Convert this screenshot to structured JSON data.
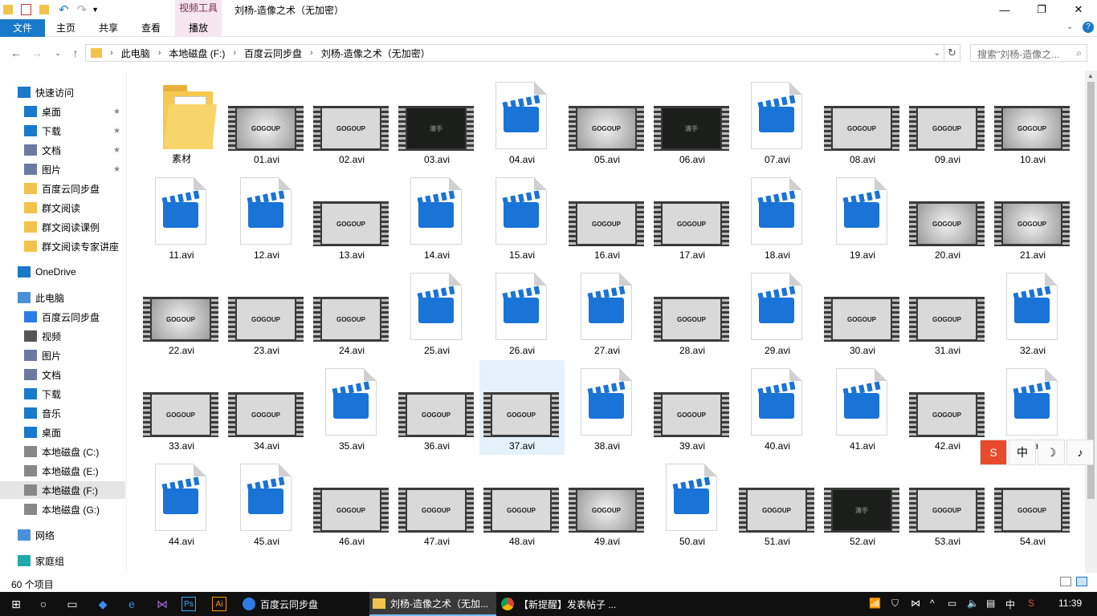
{
  "window": {
    "title": "刘杨-造像之术（无加密）",
    "context_tab_label": "视频工具",
    "help_label": "?"
  },
  "ribbon": {
    "tabs": [
      "文件",
      "主页",
      "共享",
      "查看",
      "播放"
    ]
  },
  "address": {
    "crumbs": [
      "此电脑",
      "本地磁盘 (F:)",
      "百度云同步盘",
      "刘杨-造像之术（无加密）"
    ],
    "search_placeholder": "搜索\"刘杨-造像之...",
    "icons": [
      "back-icon",
      "forward-icon",
      "recent-icon",
      "up-icon",
      "refresh-icon",
      "search-icon"
    ]
  },
  "sidebar": {
    "items": [
      {
        "label": "快速访问",
        "icon": "star-icon",
        "pinned": false
      },
      {
        "label": "桌面",
        "icon": "desktop-icon",
        "pinned": true
      },
      {
        "label": "下载",
        "icon": "download-icon",
        "pinned": true
      },
      {
        "label": "文档",
        "icon": "document-icon",
        "pinned": true
      },
      {
        "label": "图片",
        "icon": "picture-icon",
        "pinned": true
      },
      {
        "label": "百度云同步盘",
        "icon": "folder-icon",
        "pinned": false
      },
      {
        "label": "群文阅读",
        "icon": "folder-icon",
        "pinned": false
      },
      {
        "label": "群文阅读课例",
        "icon": "folder-icon",
        "pinned": false
      },
      {
        "label": "群文阅读专家讲座",
        "icon": "folder-icon",
        "pinned": false
      },
      {
        "label": "OneDrive",
        "icon": "cloud-icon",
        "pinned": false
      },
      {
        "label": "此电脑",
        "icon": "computer-icon",
        "pinned": false
      },
      {
        "label": "百度云同步盘",
        "icon": "baidu-icon",
        "pinned": false
      },
      {
        "label": "视频",
        "icon": "video-icon",
        "pinned": false
      },
      {
        "label": "图片",
        "icon": "picture-icon",
        "pinned": false
      },
      {
        "label": "文档",
        "icon": "document-icon",
        "pinned": false
      },
      {
        "label": "下载",
        "icon": "download-icon",
        "pinned": false
      },
      {
        "label": "音乐",
        "icon": "music-icon",
        "pinned": false
      },
      {
        "label": "桌面",
        "icon": "desktop-icon",
        "pinned": false
      },
      {
        "label": "本地磁盘 (C:)",
        "icon": "drive-icon",
        "pinned": false
      },
      {
        "label": "本地磁盘 (E:)",
        "icon": "drive-icon",
        "pinned": false
      },
      {
        "label": "本地磁盘 (F:)",
        "icon": "drive-icon",
        "pinned": false,
        "selected": true
      },
      {
        "label": "本地磁盘 (G:)",
        "icon": "drive-icon",
        "pinned": false
      },
      {
        "label": "网络",
        "icon": "network-icon",
        "pinned": false
      },
      {
        "label": "家庭组",
        "icon": "homegroup-icon",
        "pinned": false
      }
    ],
    "pin_glyph": "★"
  },
  "files": [
    {
      "name": "素材",
      "kind": "folder"
    },
    {
      "name": "01.avi",
      "kind": "grad"
    },
    {
      "name": "02.avi",
      "kind": "logo"
    },
    {
      "name": "03.avi",
      "kind": "dark"
    },
    {
      "name": "04.avi",
      "kind": "clap"
    },
    {
      "name": "05.avi",
      "kind": "grad"
    },
    {
      "name": "06.avi",
      "kind": "dark"
    },
    {
      "name": "07.avi",
      "kind": "clap"
    },
    {
      "name": "08.avi",
      "kind": "logo"
    },
    {
      "name": "09.avi",
      "kind": "logo"
    },
    {
      "name": "10.avi",
      "kind": "grad"
    },
    {
      "name": "11.avi",
      "kind": "clap"
    },
    {
      "name": "12.avi",
      "kind": "clap"
    },
    {
      "name": "13.avi",
      "kind": "logo"
    },
    {
      "name": "14.avi",
      "kind": "clap"
    },
    {
      "name": "15.avi",
      "kind": "clap"
    },
    {
      "name": "16.avi",
      "kind": "logo"
    },
    {
      "name": "17.avi",
      "kind": "logo"
    },
    {
      "name": "18.avi",
      "kind": "clap"
    },
    {
      "name": "19.avi",
      "kind": "clap"
    },
    {
      "name": "20.avi",
      "kind": "grad"
    },
    {
      "name": "21.avi",
      "kind": "grad"
    },
    {
      "name": "22.avi",
      "kind": "grad"
    },
    {
      "name": "23.avi",
      "kind": "logo"
    },
    {
      "name": "24.avi",
      "kind": "logo"
    },
    {
      "name": "25.avi",
      "kind": "clap"
    },
    {
      "name": "26.avi",
      "kind": "clap"
    },
    {
      "name": "27.avi",
      "kind": "clap"
    },
    {
      "name": "28.avi",
      "kind": "logo"
    },
    {
      "name": "29.avi",
      "kind": "clap"
    },
    {
      "name": "30.avi",
      "kind": "logo"
    },
    {
      "name": "31.avi",
      "kind": "logo"
    },
    {
      "name": "32.avi",
      "kind": "clap"
    },
    {
      "name": "33.avi",
      "kind": "logo"
    },
    {
      "name": "34.avi",
      "kind": "logo"
    },
    {
      "name": "35.avi",
      "kind": "clap"
    },
    {
      "name": "36.avi",
      "kind": "logo"
    },
    {
      "name": "37.avi",
      "kind": "logo",
      "selected": true
    },
    {
      "name": "38.avi",
      "kind": "clap"
    },
    {
      "name": "39.avi",
      "kind": "logo"
    },
    {
      "name": "40.avi",
      "kind": "clap"
    },
    {
      "name": "41.avi",
      "kind": "clap"
    },
    {
      "name": "42.avi",
      "kind": "logo"
    },
    {
      "name": "43.avi",
      "kind": "clap"
    },
    {
      "name": "44.avi",
      "kind": "clap"
    },
    {
      "name": "45.avi",
      "kind": "clap"
    },
    {
      "name": "46.avi",
      "kind": "logo"
    },
    {
      "name": "47.avi",
      "kind": "logo"
    },
    {
      "name": "48.avi",
      "kind": "logo"
    },
    {
      "name": "49.avi",
      "kind": "grad"
    },
    {
      "name": "50.avi",
      "kind": "clap"
    },
    {
      "name": "51.avi",
      "kind": "logo"
    },
    {
      "name": "52.avi",
      "kind": "dark"
    },
    {
      "name": "53.avi",
      "kind": "logo"
    },
    {
      "name": "54.avi",
      "kind": "logo"
    }
  ],
  "thumb_logo_text": "GOGOUP",
  "thumb_dark_text": "清手",
  "status": {
    "item_count": "60 个项目"
  },
  "ime": {
    "buttons": [
      "S",
      "中",
      "☽",
      "♪"
    ]
  },
  "taskbar": {
    "apps": [
      {
        "label": "百度云同步盘",
        "active": false
      },
      {
        "label": "刘杨-造像之术（无加...",
        "active": true
      },
      {
        "label": "【新提醒】发表帖子 ...",
        "active": false
      }
    ],
    "tray_lang": "中",
    "time": "11:39"
  },
  "colors": {
    "accent": "#1979ca",
    "clapper": "#1a73d6",
    "context_tab": "#f6e6ef",
    "selection": "#e5f1fb"
  }
}
